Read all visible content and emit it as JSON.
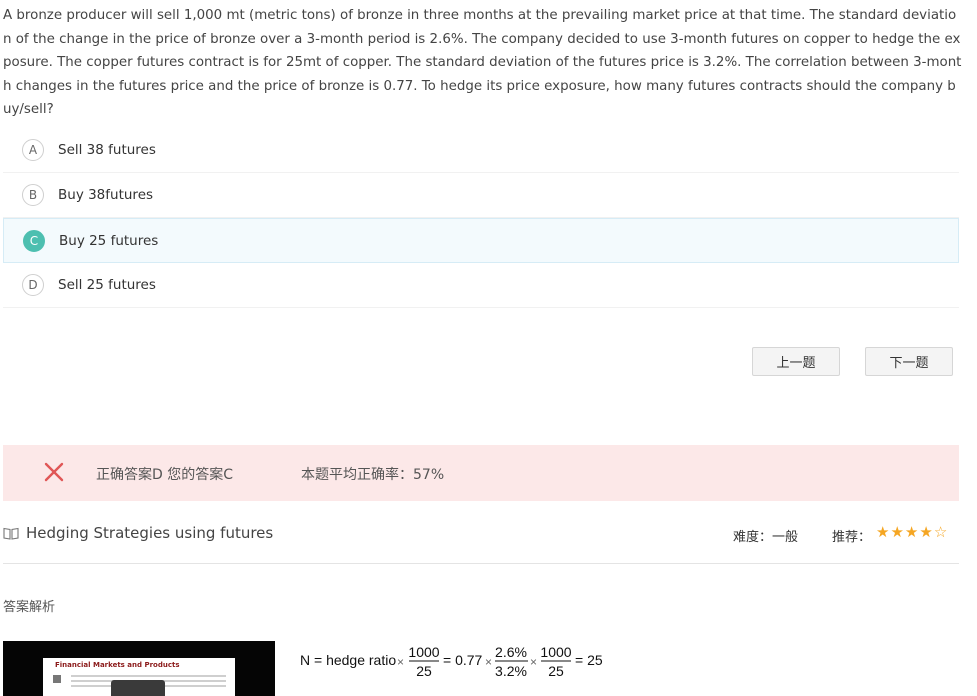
{
  "question": {
    "text": "A bronze producer will sell 1,000 mt (metric tons) of bronze in three months at the prevailing market price at that time. The standard deviation of the change in the price of bronze over a 3-month period is 2.6%. The company decided to use 3-month futures on copper to hedge the exposure. The copper futures contract is for 25mt of copper. The standard deviation of the futures price is 3.2%. The correlation between 3-month changes in the futures price and the price of bronze is 0.77. To hedge its price exposure, how many futures contracts should the company buy/sell?"
  },
  "options": [
    {
      "letter": "A",
      "text": "Sell 38 futures"
    },
    {
      "letter": "B",
      "text": "Buy 38futures"
    },
    {
      "letter": "C",
      "text": "Buy 25 futures"
    },
    {
      "letter": "D",
      "text": "Sell 25 futures"
    }
  ],
  "selected_option": "C",
  "nav": {
    "prev": "上一题",
    "next": "下一题"
  },
  "result": {
    "answer_text": "正确答案D 您的答案C",
    "avg_text": "本题平均正确率：57%"
  },
  "topic": {
    "title": "Hedging Strategies using futures",
    "difficulty": "难度：一般",
    "recommend_label": "推荐：",
    "stars": 4,
    "stars_max": 5
  },
  "analysis": {
    "label": "答案解析",
    "slide_title": "Financial Markets and Products",
    "formula": {
      "lhs": "N = hedge ratio",
      "frac1_num": "1000",
      "frac1_den": "25",
      "eq1": "= 0.77",
      "frac2_num": "2.6%",
      "frac2_den": "3.2%",
      "frac3_num": "1000",
      "frac3_den": "25",
      "result": "= 25"
    }
  },
  "colors": {
    "accent": "#4dbfb0",
    "error_bg": "#fce8e8",
    "error_icon": "#e05656",
    "star": "#f5a623"
  }
}
